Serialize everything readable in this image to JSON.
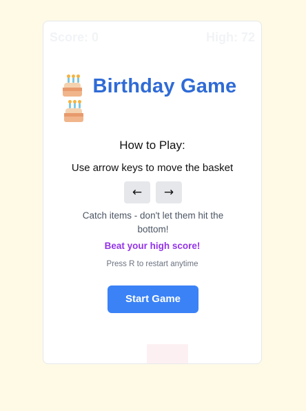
{
  "hud": {
    "score_label": "Score: 0",
    "high_label": "High: 72"
  },
  "title": {
    "text": "Birthday Game",
    "icon": "birthday-cake-icon"
  },
  "instructions": {
    "heading": "How to Play:",
    "controls": "Use arrow keys to move the basket",
    "left_key": "←",
    "right_key": "→",
    "catch_text": "Catch items - don't let them hit the bottom!",
    "beat_text": "Beat your high score!",
    "restart_text": "Press R to restart anytime"
  },
  "start_button": {
    "label": "Start Game"
  },
  "colors": {
    "background": "#fefae6",
    "title": "#2f6bd6",
    "accent_purple": "#9333ea",
    "button": "#3b82f6"
  }
}
